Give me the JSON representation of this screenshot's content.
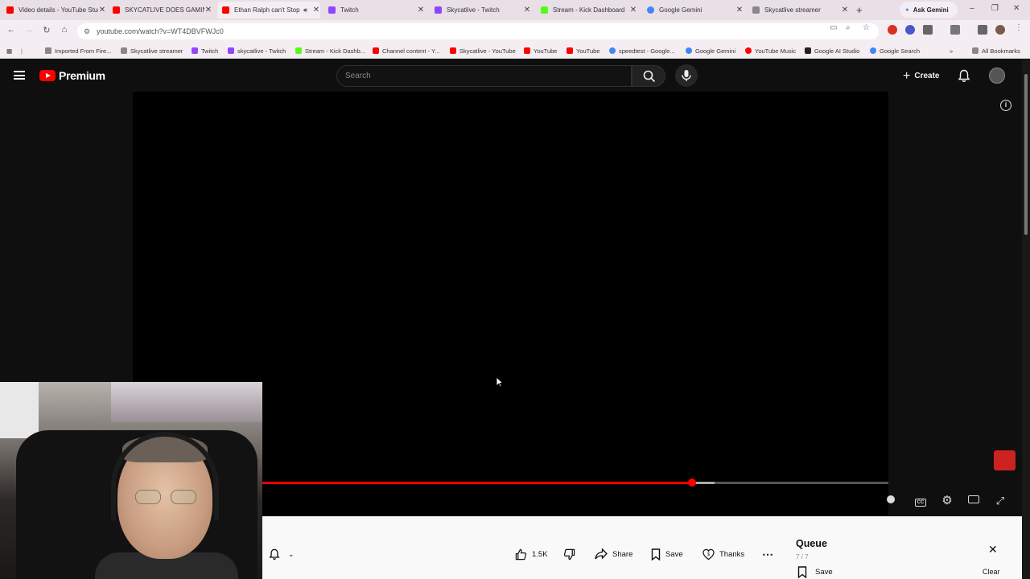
{
  "browser": {
    "tabs": [
      {
        "title": "Video details - YouTube Studio",
        "favicon_color": "#ff0000",
        "active": false
      },
      {
        "title": "SKYCATLIVE DOES GAMING",
        "favicon_color": "#ff0000",
        "active": false
      },
      {
        "title": "Ethan Ralph can't Stop",
        "favicon_color": "#ff0000",
        "active": true
      },
      {
        "title": "Twitch",
        "favicon_color": "#9146ff",
        "active": false
      },
      {
        "title": "Skycatlive - Twitch",
        "favicon_color": "#9146ff",
        "active": false
      },
      {
        "title": "Stream - Kick Dashboard",
        "favicon_color": "#53fc18",
        "active": false
      },
      {
        "title": "Google Gemini",
        "favicon_color": "#4285f4",
        "active": false
      },
      {
        "title": "Skycatlive streamer",
        "favicon_color": "#888888",
        "active": false
      }
    ],
    "ask_gemini": "Ask Gemini",
    "url": "youtube.com/watch?v=WT4DBVFWJc0",
    "bookmarks": [
      {
        "label": "Imported From Fire...",
        "color": "#888888"
      },
      {
        "label": "Skycatlive streamer",
        "color": "#888888"
      },
      {
        "label": "Twitch",
        "color": "#9146ff"
      },
      {
        "label": "skycatlive - Twitch",
        "color": "#9146ff"
      },
      {
        "label": "Stream - Kick Dashb...",
        "color": "#53fc18"
      },
      {
        "label": "Channel content - Y...",
        "color": "#ff0000"
      },
      {
        "label": "Skycatlive - YouTube",
        "color": "#ff0000"
      },
      {
        "label": "YouTube",
        "color": "#ff0000"
      },
      {
        "label": "YouTube",
        "color": "#ff0000"
      },
      {
        "label": "speedtest - Google...",
        "color": "#4285f4"
      },
      {
        "label": "Google Gemini",
        "color": "#4285f4"
      },
      {
        "label": "YouTube Music",
        "color": "#ff0000"
      },
      {
        "label": "Google AI Studio",
        "color": "#222222"
      },
      {
        "label": "Google Search",
        "color": "#4285f4"
      }
    ],
    "all_bookmarks": "All Bookmarks"
  },
  "youtube": {
    "logo_text": "Premium",
    "search_placeholder": "Search",
    "create_label": "Create",
    "player": {
      "progress_played_fraction": 0.686,
      "progress_buffered_fraction": 0.722
    },
    "actions": {
      "like_count": "1.5K",
      "share_label": "Share",
      "save_label": "Save",
      "thanks_label": "Thanks"
    },
    "queue": {
      "title": "Queue",
      "count": "7 / 7",
      "save_label": "Save",
      "clear_label": "Clear"
    }
  },
  "colors": {
    "accent_red": "#ff0000",
    "page_bg": "#0f0f0f",
    "panel_bg": "#f9f9f9"
  }
}
